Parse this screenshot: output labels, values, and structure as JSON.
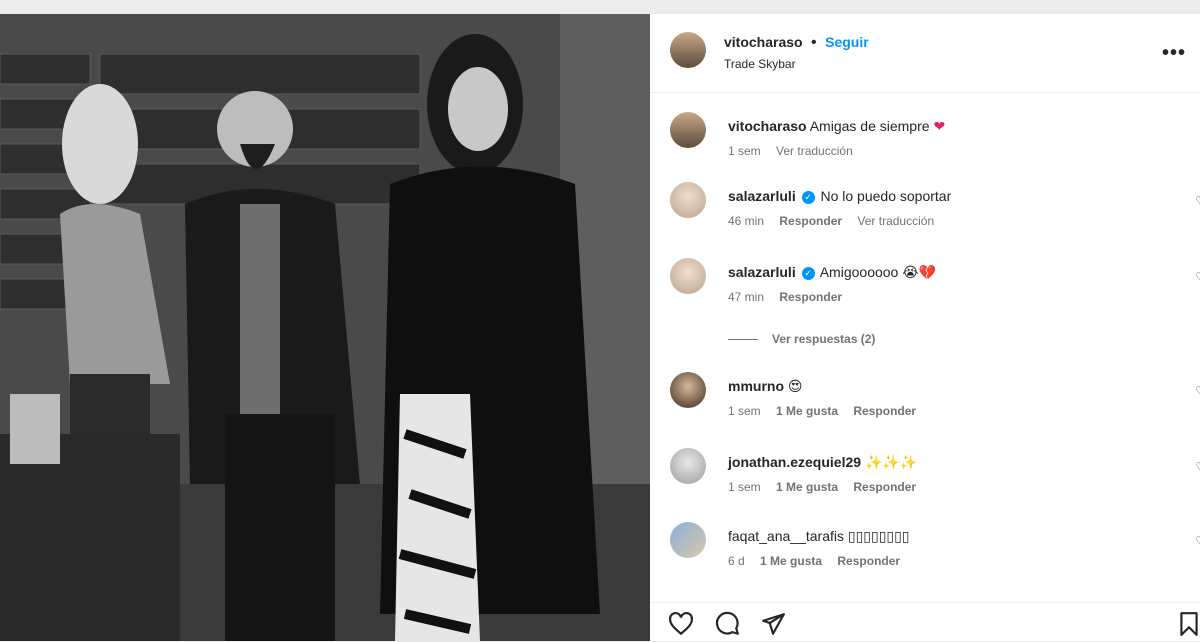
{
  "post": {
    "username": "vitocharaso",
    "separator": "•",
    "follow_label": "Seguir",
    "location": "Trade Skybar",
    "more_label": "•••"
  },
  "caption": {
    "username": "vitocharaso",
    "text": "Amigas de siempre",
    "emoji": "❤",
    "time": "1 sem",
    "translate": "Ver traducción"
  },
  "comments": [
    {
      "username": "salazarluli",
      "verified": true,
      "text": "No lo puedo soportar",
      "time": "46 min",
      "reply": "Responder",
      "translate": "Ver traducción",
      "likes": ""
    },
    {
      "username": "salazarluli",
      "verified": true,
      "text": "Amigoooooo 😭💔",
      "time": "47 min",
      "reply": "Responder",
      "translate": "",
      "likes": ""
    },
    {
      "username": "mmurno",
      "verified": false,
      "text": "😍",
      "time": "1 sem",
      "reply": "Responder",
      "translate": "",
      "likes": "1 Me gusta"
    },
    {
      "username": "jonathan.ezequiel29",
      "verified": false,
      "text": "✨✨✨",
      "time": "1 sem",
      "reply": "Responder",
      "translate": "",
      "likes": "1 Me gusta"
    },
    {
      "username": "faqat_ana__tarafis",
      "verified": false,
      "text": "▯▯▯▯▯▯▯▯",
      "time": "6 d",
      "reply": "Responder",
      "translate": "",
      "likes": "1 Me gusta"
    }
  ],
  "view_replies": "Ver respuestas (2)",
  "icons": {
    "like": "heart-icon",
    "comment": "comment-icon",
    "share": "share-icon",
    "save": "bookmark-icon",
    "comment_like": "small-heart-icon"
  }
}
